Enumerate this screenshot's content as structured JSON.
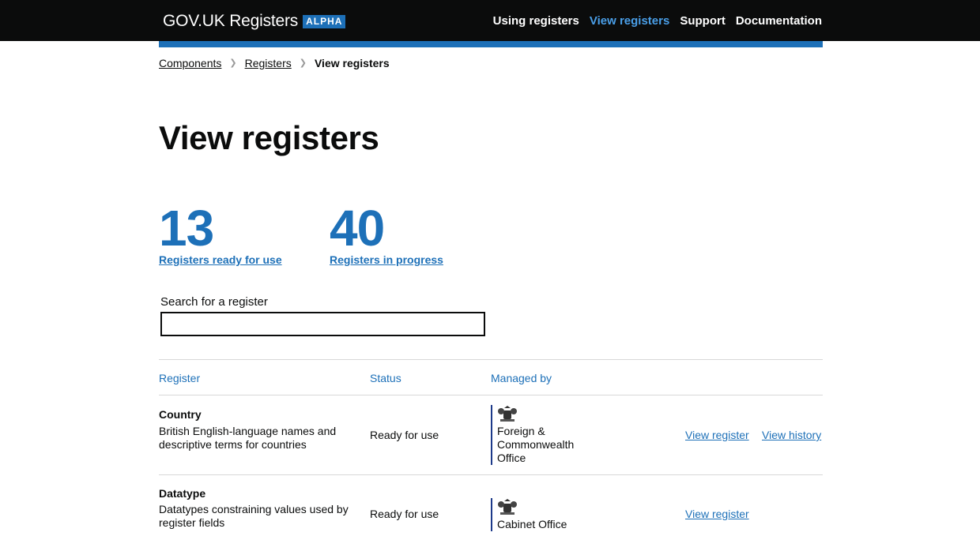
{
  "header": {
    "logo_text": "GOV.UK Registers",
    "badge": "ALPHA",
    "nav": [
      "Using registers",
      "View registers",
      "Support",
      "Documentation"
    ]
  },
  "breadcrumb": [
    "Components",
    "Registers",
    "View registers"
  ],
  "page_title": "View registers",
  "stats": [
    {
      "value": "13",
      "label": "Registers ready for use"
    },
    {
      "value": "40",
      "label": "Registers in progress"
    }
  ],
  "search": {
    "label": "Search for a register",
    "value": "",
    "placeholder": ""
  },
  "table": {
    "headers": [
      "Register",
      "Status",
      "Managed by"
    ],
    "rows": [
      {
        "name": "Country",
        "description": "British English-language names and descriptive terms for countries",
        "status": "Ready for use",
        "organisation": "Foreign & Commonwealth Office",
        "links": [
          "View register",
          "View history"
        ]
      },
      {
        "name": "Datatype",
        "description": "Datatypes constraining values used by register fields",
        "status": "Ready for use",
        "organisation": "Cabinet Office",
        "links": [
          "View register"
        ]
      }
    ]
  },
  "colors": {
    "header_bg": "#0b0c0c",
    "brand_blue": "#1d70b8",
    "nav_active": "#4a9fe8",
    "org_rule": "#1d3a8a"
  },
  "icons": {
    "breadcrumb_separator": "chevron-right-icon",
    "organisation": "royal-crest-icon"
  }
}
